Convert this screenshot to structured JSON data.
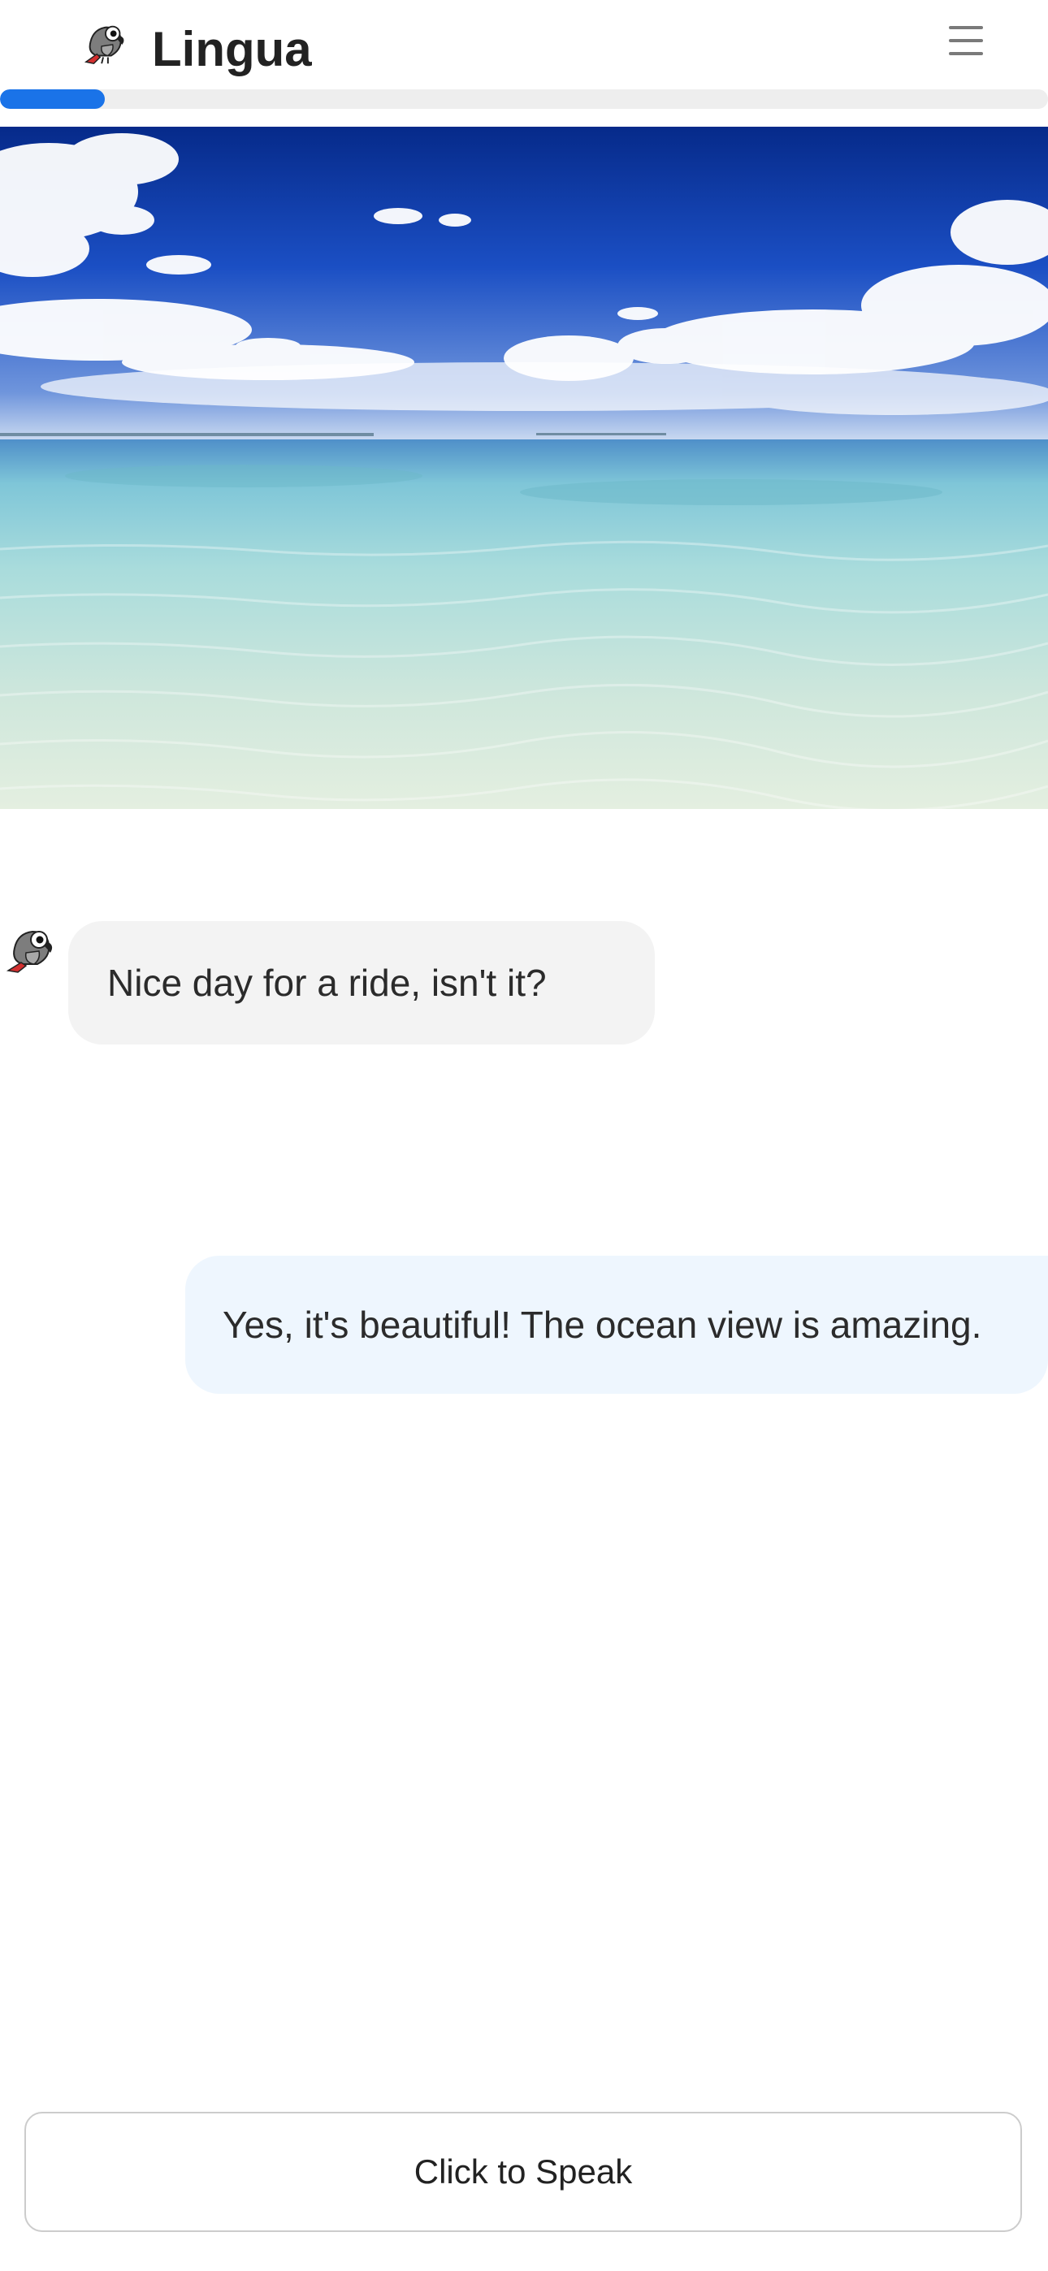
{
  "header": {
    "app_name": "Lingua",
    "logo_icon": "parrot-icon",
    "menu_icon": "hamburger-menu-icon"
  },
  "progress": {
    "fraction": 0.1,
    "color": "#1a73e8"
  },
  "hero": {
    "subject": "tropical ocean and sky scene"
  },
  "chat": {
    "messages": [
      {
        "role": "bot",
        "text": "Nice day for a ride, isn't it?"
      },
      {
        "role": "user",
        "text": "Yes, it's beautiful! The ocean view is amazing."
      }
    ]
  },
  "footer": {
    "speak_label": "Click to Speak"
  },
  "colors": {
    "accent": "#1a73e8",
    "bot_bubble": "#f3f3f3",
    "user_bubble": "#eef6fe"
  }
}
